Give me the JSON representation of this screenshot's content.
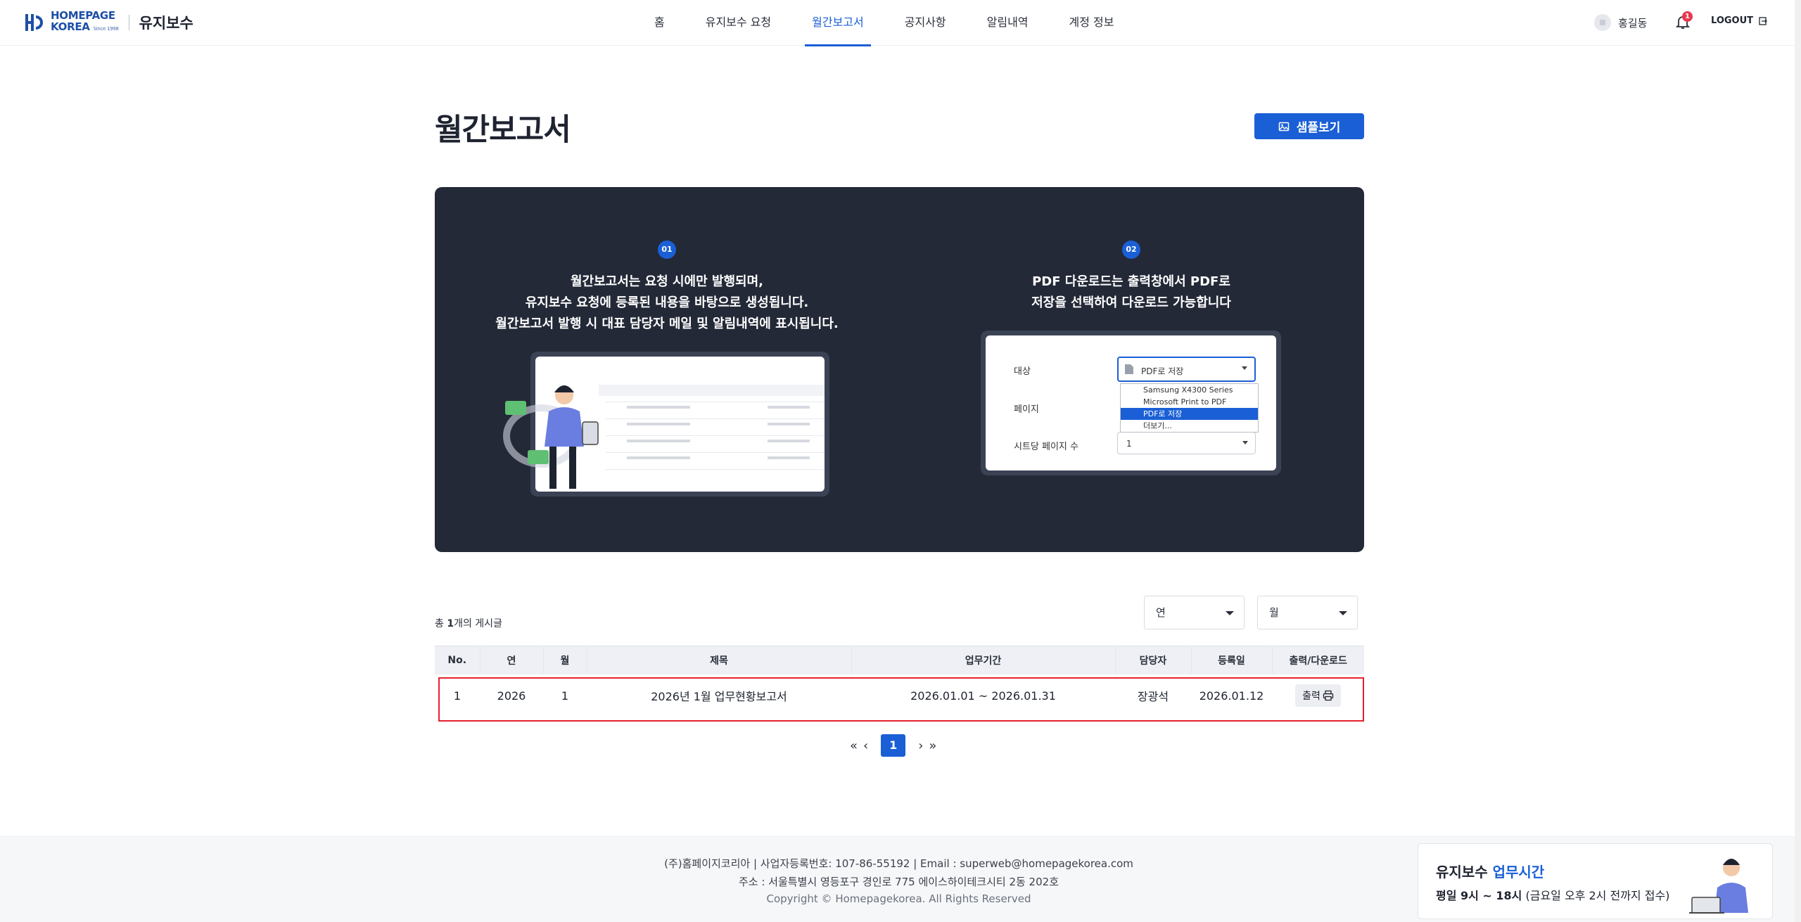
{
  "header": {
    "logo_line1": "HOMEPAGE",
    "logo_line2": "KOREA",
    "logo_since": "Since 1998",
    "title": "유지보수",
    "nav": [
      "홈",
      "유지보수 요청",
      "월간보고서",
      "공지사항",
      "알림내역",
      "계정 정보"
    ],
    "active_nav": "월간보고서",
    "user_name": "홍길동",
    "notification_count": "1",
    "logout_label": "LOGOUT"
  },
  "page": {
    "title": "월간보고서",
    "sample_button": "샘플보기"
  },
  "info": {
    "step1_num": "01",
    "step1_text": [
      "월간보고서는 요청 시에만 발행되며,",
      "유지보수 요청에 등록된 내용을 바탕으로 생성됩니다.",
      "월간보고서 발행 시 대표 담당자 메일 및 알림내역에 표시됩니다."
    ],
    "step2_num": "02",
    "step2_text": [
      "PDF 다운로드는 출력창에서 PDF로",
      "저장을 선택하여 다운로드 가능합니다"
    ],
    "print_dialog": {
      "target_label": "대상",
      "target_value": "PDF로 저장",
      "page_label": "페이지",
      "per_sheet_label": "시트당 페이지 수",
      "per_sheet_value": "1",
      "options": [
        "Samsung X4300 Series",
        "Microsoft Print to PDF",
        "PDF로 저장",
        "더보기..."
      ],
      "selected_option": "PDF로 저장"
    }
  },
  "list": {
    "total_prefix": "총 ",
    "total_count": "1",
    "total_suffix": "개의 게시글",
    "filter_year": "연",
    "filter_month": "월",
    "columns": [
      "No.",
      "연",
      "월",
      "제목",
      "업무기간",
      "담당자",
      "등록일",
      "출력/다운로드"
    ],
    "rows": [
      {
        "no": "1",
        "year": "2026",
        "month": "1",
        "title": "2026년 1월 업무현황보고서",
        "period": "2026.01.01 ~ 2026.01.31",
        "manager": "장광석",
        "date": "2026.01.12",
        "action": "출력"
      }
    ],
    "current_page": "1"
  },
  "footer": {
    "line1": "(주)홈페이지코리아  |  사업자등록번호: 107-86-55192  |  Email : superweb@homepagekorea.com",
    "line2": "주소 : 서울특별시 영등포구 경인로 775 에이스하이테크시티 2동 202호",
    "copyright": "Copyright © Homepagekorea. All Rights Reserved",
    "hours_title_a": "유지보수 ",
    "hours_title_b": "업무시간",
    "hours_detail_a": "평일 9시 ~ 18시",
    "hours_detail_b": " (금요일 오후 2시 전까지 접수)"
  },
  "colors": {
    "accent": "#1a5fd6",
    "panel": "#232937",
    "highlight_border": "#e6212f"
  }
}
